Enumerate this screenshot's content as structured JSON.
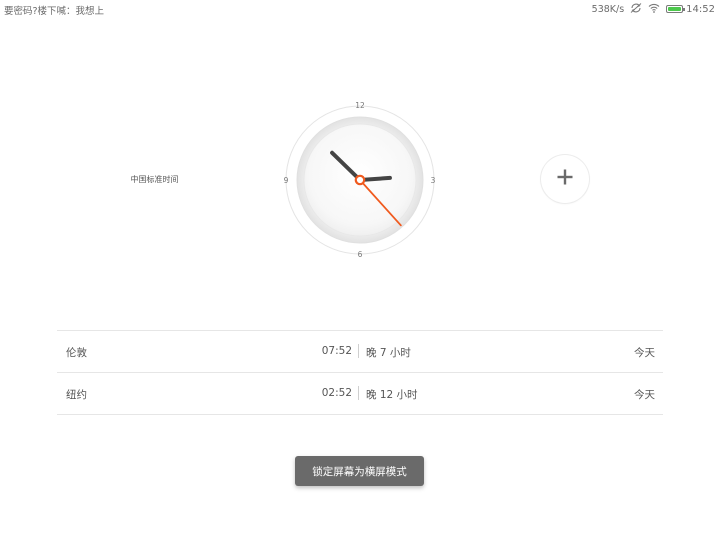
{
  "status_bar": {
    "notification_text": "要密码?楼下喊：我想上",
    "network_speed": "538K/s",
    "icons": [
      "sync-off-icon",
      "wifi-icon",
      "battery-icon"
    ],
    "battery_color": "#4cc84c",
    "time": "14:52"
  },
  "clock": {
    "timezone_label": "中国标准时间",
    "dial_numbers": {
      "top": "12",
      "right": "3",
      "bottom": "6",
      "left": "9"
    },
    "time": {
      "hour": 14,
      "minute": 52,
      "second": 23
    },
    "hand_color": "#444444",
    "second_hand_color": "#f05a1e"
  },
  "add_button": {
    "icon": "plus-icon"
  },
  "world_clocks": [
    {
      "city": "伦敦",
      "time": "07:52",
      "diff": "晚 7 小时",
      "day": "今天"
    },
    {
      "city": "纽约",
      "time": "02:52",
      "diff": "晚 12 小时",
      "day": "今天"
    }
  ],
  "toast": {
    "text": "锁定屏幕为横屏模式"
  }
}
